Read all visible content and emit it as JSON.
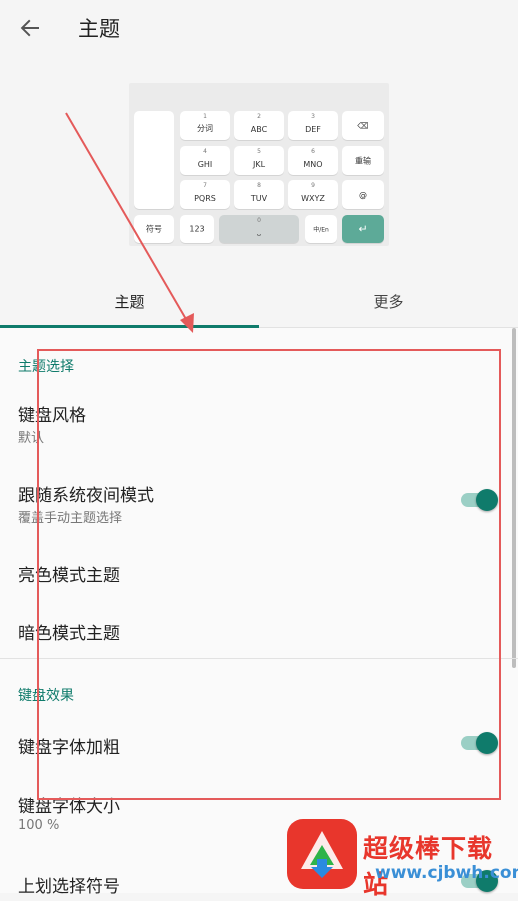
{
  "header": {
    "title": "主题",
    "back_icon": "arrow-left-icon"
  },
  "keyboard_preview": {
    "row1": [
      {
        "num": "1",
        "label": "分词"
      },
      {
        "num": "2",
        "label": "ABC"
      },
      {
        "num": "3",
        "label": "DEF"
      },
      {
        "num": "",
        "label": "⌫"
      }
    ],
    "row2": [
      {
        "num": "4",
        "label": "GHI"
      },
      {
        "num": "5",
        "label": "JKL"
      },
      {
        "num": "6",
        "label": "MNO"
      },
      {
        "num": "",
        "label": "重输"
      }
    ],
    "row3": [
      {
        "num": "7",
        "label": "PQRS"
      },
      {
        "num": "8",
        "label": "TUV"
      },
      {
        "num": "9",
        "label": "WXYZ"
      },
      {
        "num": "",
        "label": "@"
      }
    ],
    "bottom": {
      "symbol": "符号",
      "num123": "123",
      "space_num": "0",
      "space_label": "⎵",
      "lang": "中/En",
      "enter": "↵"
    },
    "accent_color": "#5daa98"
  },
  "tabs": {
    "theme": "主题",
    "more": "更多"
  },
  "sections": {
    "theme": {
      "header": "主题选择",
      "keyboard_style": {
        "title": "键盘风格",
        "value": "默认"
      },
      "follow_night": {
        "title": "跟随系统夜间模式",
        "subtitle": "覆盖手动主题选择",
        "enabled": true
      },
      "light_theme": {
        "title": "亮色模式主题"
      },
      "dark_theme": {
        "title": "暗色模式主题"
      }
    },
    "effects": {
      "header": "键盘效果",
      "bold_font": {
        "title": "键盘字体加粗",
        "enabled": true
      },
      "font_size": {
        "title": "键盘字体大小",
        "value": "100 %"
      },
      "swipe_symbol": {
        "title": "上划选择符号",
        "enabled": true
      }
    }
  },
  "watermark": {
    "text": "超级棒下载站",
    "url": "www.cjbwh.com"
  },
  "colors": {
    "accent": "#0f7b6b",
    "annotation": "#e45a5a"
  }
}
